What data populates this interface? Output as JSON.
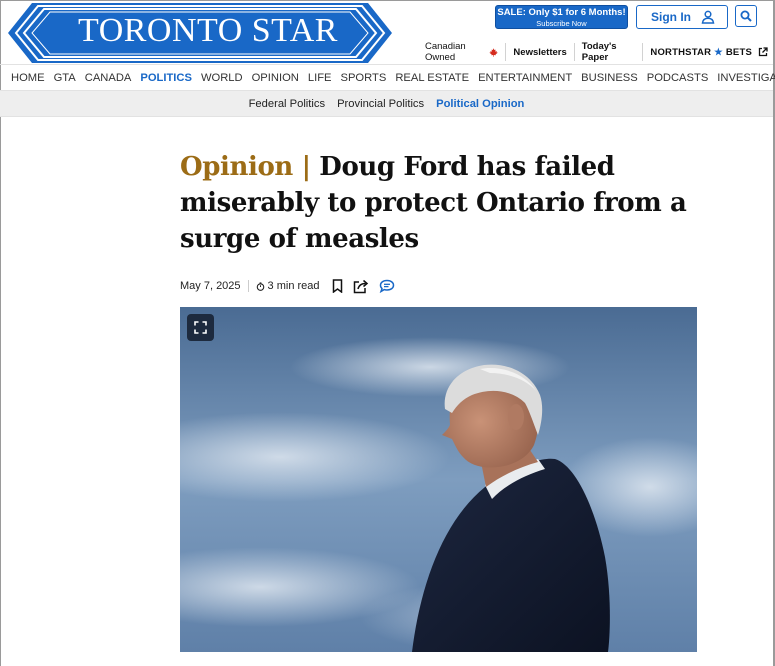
{
  "header": {
    "logo_text": "TORONTO STAR",
    "sale": {
      "line1": "SALE: Only $1 for 6 Months!",
      "line2": "Subscribe Now"
    },
    "sign_in_label": "Sign In",
    "utility_links": {
      "canadian_owned": "Canadian Owned",
      "newsletters": "Newsletters",
      "todays_paper": "Today's Paper",
      "northstar_prefix": "NORTHSTAR",
      "northstar_suffix": "BETS"
    }
  },
  "primary_nav": [
    "HOME",
    "GTA",
    "CANADA",
    "POLITICS",
    "WORLD",
    "OPINION",
    "LIFE",
    "SPORTS",
    "REAL ESTATE",
    "ENTERTAINMENT",
    "BUSINESS",
    "PODCASTS",
    "INVESTIGATIONS"
  ],
  "primary_nav_active": "POLITICS",
  "sub_nav": [
    "Federal Politics",
    "Provincial Politics",
    "Political Opinion"
  ],
  "sub_nav_active": "Political Opinion",
  "article": {
    "kicker": "Opinion |",
    "title": "Doug Ford has failed miserably to protect Ontario from a surge of measles",
    "date": "May 7, 2025",
    "read_time": "3 min read"
  },
  "icons": {
    "search": "search-icon",
    "user": "user-icon",
    "maple_leaf": "maple-leaf-icon",
    "external_link": "external-link-icon",
    "timer": "timer-icon",
    "bookmark": "bookmark-icon",
    "share": "share-icon",
    "comment": "comment-icon",
    "expand": "expand-icon"
  },
  "colors": {
    "brand_blue": "#1968c7",
    "kicker_gold": "#9c6c16",
    "maple_red": "#d52b1e",
    "subnav_bg": "#eeeeee"
  }
}
